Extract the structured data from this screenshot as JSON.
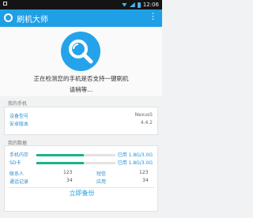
{
  "status_bar": {
    "time": "12:06"
  },
  "app_bar": {
    "title": "刷机大师",
    "menu_glyph": "⋮"
  },
  "hero": {
    "message": "正在检测您的手机是否支持一键刷机",
    "wait_text": "请稍等..."
  },
  "my_phone": {
    "label": "我的手机",
    "rows": [
      {
        "key": "设备型号",
        "value": "NexusS"
      },
      {
        "key": "安卓版本",
        "value": "4.4.2"
      }
    ]
  },
  "my_data": {
    "label": "我的数据",
    "storage": [
      {
        "key": "手机内存",
        "used_text": "已用 1.8G/3.0G",
        "fill_fraction": 0.6
      },
      {
        "key": "SD卡",
        "used_text": "已用 1.8G/3.0G",
        "fill_fraction": 0.6
      }
    ],
    "stats": [
      {
        "key": "联系人",
        "value": "123"
      },
      {
        "key": "通话记录",
        "value": "34"
      },
      {
        "key": "短信",
        "value": "123"
      },
      {
        "key": "应用",
        "value": "34"
      }
    ],
    "backup_button": "立即备份"
  },
  "colors": {
    "accent": "#1f9fe6",
    "progress": "#19b28c"
  }
}
